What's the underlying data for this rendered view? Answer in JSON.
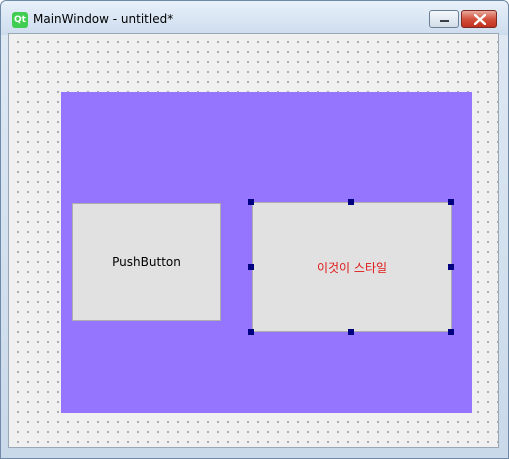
{
  "window": {
    "title": "MainWindow - untitled*",
    "app_icon_label": "Qt"
  },
  "form": {
    "panel_color": "#9575fe",
    "push_button_label": "PushButton",
    "styled_button_label": "이것이 스타일",
    "styled_button_text_color": "#e01818",
    "selection_handle_color": "#000080"
  }
}
